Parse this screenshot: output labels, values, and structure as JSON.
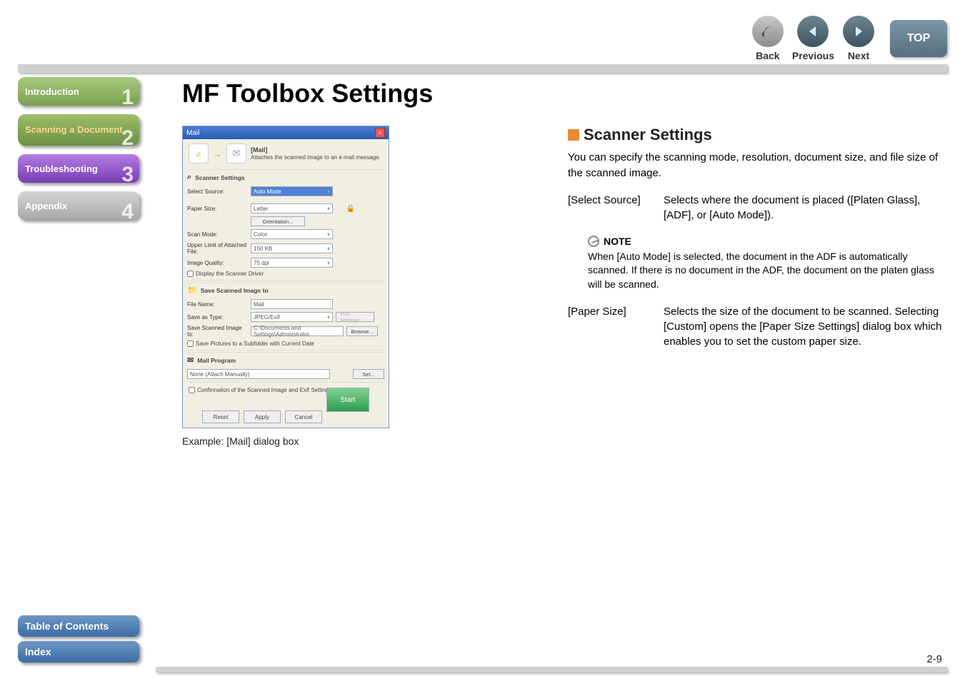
{
  "topbar": {
    "back": "Back",
    "previous": "Previous",
    "next": "Next",
    "top": "TOP"
  },
  "sidebar": {
    "intro": "Introduction",
    "scan": "Scanning a Document",
    "trouble": "Troubleshooting",
    "appendix": "Appendix",
    "num1": "1",
    "num2": "2",
    "num3": "3",
    "num4": "4",
    "toc": "Table of Contents",
    "index": "Index"
  },
  "main": {
    "title": "MF Toolbox Settings",
    "caption": "Example: [Mail] dialog box"
  },
  "dialog": {
    "titlebar": "Mail",
    "close": "×",
    "head_title": "[Mail]",
    "head_desc": "Attaches the scanned image to an e-mail message.",
    "arrow": "→",
    "scanner_settings": "Scanner Settings",
    "select_source_label": "Select Source:",
    "select_source_value": "Auto Mode",
    "paper_size_label": "Paper Size:",
    "paper_size_value": "Letter",
    "orientation_btn": "Orientation...",
    "lock_icon": "🔒",
    "scan_mode_label": "Scan Mode:",
    "scan_mode_value": "Color",
    "upper_limit_label": "Upper Limit of Attached File:",
    "upper_limit_value": "150 KB",
    "image_quality_label": "Image Quality:",
    "image_quality_value": "75 dpi",
    "display_driver": "Display the Scanner Driver",
    "save_section": "Save Scanned Image to",
    "file_name_label": "File Name:",
    "file_name_value": "Mail",
    "save_as_type_label": "Save as Type:",
    "save_as_type_value": "JPEG/Exif",
    "pdf_settings_btn": "PDF Settings...",
    "save_to_label": "Save Scanned Image to:",
    "save_to_value": "C:\\Documents and Settings\\Administrator",
    "browse_btn": "Browse...",
    "save_subfolder": "Save Pictures to a Subfolder with Current Date",
    "mail_program": "Mail Program",
    "mail_program_value": "None (Attach Manually)",
    "set_btn": "Set...",
    "confirmation": "Confirmation of the Scanned Image and Exif Settings",
    "reset": "Reset",
    "apply": "Apply",
    "cancel": "Cancel",
    "start": "Start"
  },
  "right": {
    "heading": "Scanner Settings",
    "intro": "You can specify the scanning mode, resolution, document size, and file size of the scanned image.",
    "select_source_term": "[Select Source]",
    "select_source_desc": "Selects where the document is placed ([Platen Glass], [ADF], or [Auto Mode]).",
    "note_label": "NOTE",
    "note_text": "When [Auto Mode] is selected, the document in the ADF is automatically scanned. If there is no document in the ADF, the document on the platen glass will be scanned.",
    "paper_size_term": "[Paper Size]",
    "paper_size_desc": "Selects the size of the document to be scanned. Selecting [Custom] opens the [Paper Size Settings] dialog box which enables you to set the custom paper size."
  },
  "page_number": "2-9"
}
